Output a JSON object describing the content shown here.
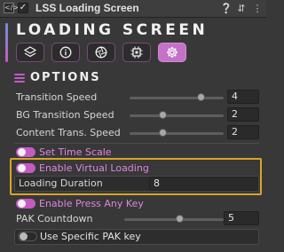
{
  "header": {
    "title": "LSS Loading Screen",
    "script_icon": "script-icon",
    "enabled_check": "✓",
    "right_icons": [
      "help-icon",
      "preset-icon",
      "menu-icon"
    ]
  },
  "panel": {
    "title": "LOADING SCREEN",
    "tabs": [
      {
        "icon": "layers-icon",
        "active": false
      },
      {
        "icon": "info-icon",
        "active": false
      },
      {
        "icon": "aperture-icon",
        "active": false
      },
      {
        "icon": "chip-icon",
        "active": false
      },
      {
        "icon": "gear-icon",
        "active": true
      }
    ],
    "accent_color": "#c45ac2",
    "highlight_color": "#d8a526"
  },
  "options": {
    "heading": "OPTIONS",
    "transition_speed": {
      "label": "Transition Speed",
      "value": "4",
      "level": 0.75
    },
    "bg_transition_speed": {
      "label": "BG Transition Speed",
      "value": "2",
      "level": 0.35
    },
    "content_trans_speed": {
      "label": "Content Trans. Speed",
      "value": "2",
      "level": 0.35
    },
    "set_time_scale": {
      "label": "Set Time Scale",
      "on": true
    },
    "enable_virtual_loading": {
      "label": "Enable Virtual Loading",
      "on": true
    },
    "loading_duration": {
      "label": "Loading Duration",
      "value": "8"
    },
    "enable_press_any_key": {
      "label": "Enable Press Any Key",
      "on": true
    },
    "pak_countdown": {
      "label": "PAK Countdown",
      "value": "5",
      "level": 0.55
    },
    "use_specific_pak_key": {
      "label": "Use Specific PAK key",
      "on": false
    }
  }
}
